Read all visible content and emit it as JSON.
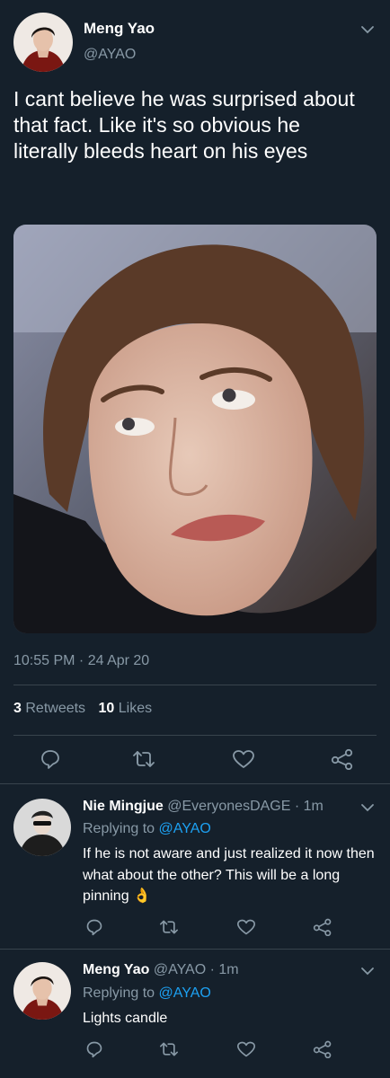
{
  "main_tweet": {
    "author_name": "Meng Yao",
    "author_handle": "@AYAO",
    "text": "I cant believe he was surprised about that fact. Like it's so obvious he literally bleeds heart on his eyes",
    "timestamp": "10:55 PM · 24 Apr 20",
    "retweets_count": "3",
    "retweets_label": "Retweets",
    "likes_count": "10",
    "likes_label": "Likes"
  },
  "replies": [
    {
      "author_name": "Nie Mingjue",
      "author_handle": "@EveryonesDAGE",
      "time": "· 1m",
      "replying_prefix": "Replying to",
      "replying_to": "@AYAO",
      "text": "If he is not aware and just realized it now then what about the other? This will be a long pinning",
      "emoji": "👌"
    },
    {
      "author_name": "Meng Yao",
      "author_handle": "@AYAO",
      "time": "· 1m",
      "replying_prefix": "Replying to",
      "replying_to": "@AYAO",
      "text": "Lights candle"
    }
  ],
  "icons": {
    "reply": "reply-icon",
    "retweet": "retweet-icon",
    "like": "heart-icon",
    "share": "share-icon",
    "more": "chevron-down-icon"
  },
  "colors": {
    "background": "#15202b",
    "divider": "#38444d",
    "muted": "#8899a6",
    "accent": "#1da1f2",
    "text": "#ffffff"
  }
}
